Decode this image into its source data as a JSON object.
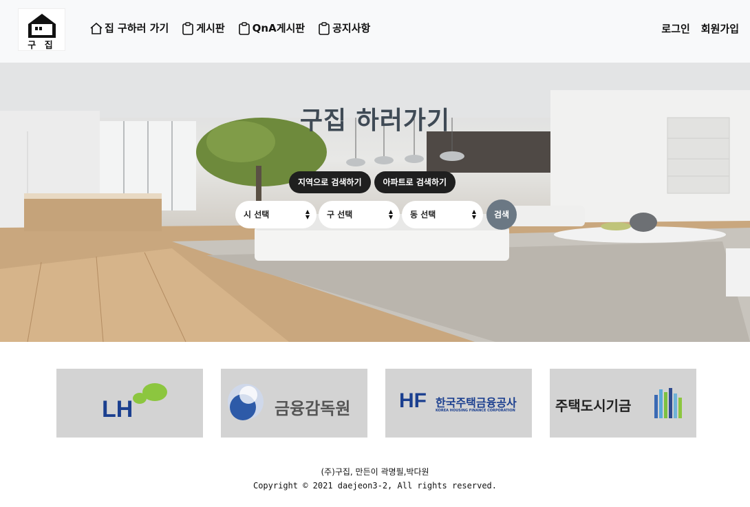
{
  "header": {
    "logo_text": "구 집",
    "nav": [
      {
        "label": "집 구하러 가기",
        "icon": "home-icon"
      },
      {
        "label": "게시판",
        "icon": "clipboard-icon"
      },
      {
        "label": "QnA게시판",
        "icon": "clipboard-icon"
      },
      {
        "label": "공지사항",
        "icon": "clipboard-icon"
      }
    ],
    "login": "로그인",
    "signup": "회원가입"
  },
  "hero": {
    "title": "구집 하러가기",
    "tabs": [
      "지역으로 검색하기",
      "아파트로 검색하기"
    ],
    "selects": [
      "시 선택",
      "구 선택",
      "동 선택"
    ],
    "search_button": "검색"
  },
  "banners": [
    {
      "name": "LH",
      "text": "LH",
      "color": "#1b3f8f"
    },
    {
      "name": "금융감독원",
      "text": "금융감독원",
      "color": "#555555"
    },
    {
      "name": "한국주택금융공사",
      "text": "한국주택금융공사",
      "sub": "KOREA HOUSING FINANCE CORPORATION",
      "color": "#1b3f8f"
    },
    {
      "name": "주택도시기금",
      "text": "주택도시기금",
      "color": "#222222"
    }
  ],
  "footer": {
    "line1": "(주)구집, 만든이 곽명필,박다원",
    "line2": "Copyright © 2021 daejeon3-2, All rights reserved."
  },
  "colors": {
    "header_bg": "#f8f9fa",
    "tab_bg": "#1f1f1f",
    "search_button_bg": "#6b7884",
    "banner_bg": "#d3d3d3",
    "title_color": "#3f4a55"
  }
}
